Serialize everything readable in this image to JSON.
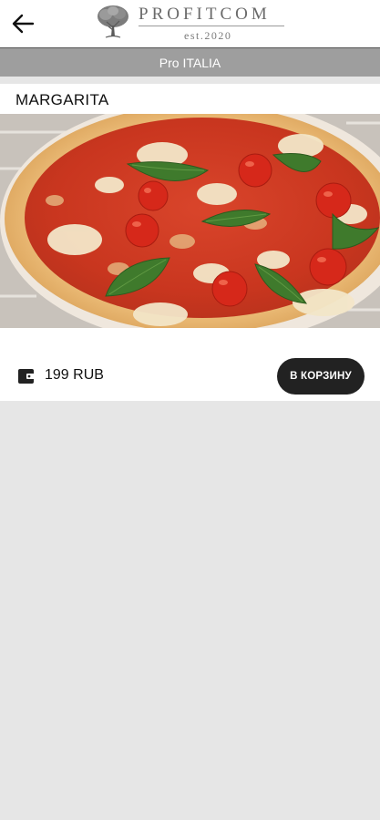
{
  "header": {
    "back_icon": "arrow-left-icon",
    "brand_name": "PROFITCOM",
    "brand_tagline": "est.2020",
    "brand_icon": "tree-logo-icon"
  },
  "category": {
    "label": "Pro ITALIA"
  },
  "product": {
    "title": "MARGARITA",
    "image_description_icon": "pizza-image",
    "price_icon": "wallet-icon",
    "price": "199 RUB",
    "cart_button_label": "В КОРЗИНУ"
  },
  "colors": {
    "header_bg": "#ffffff",
    "category_bar_bg": "#9e9e9e",
    "page_bg": "#e6e6e6",
    "button_bg": "#222222"
  }
}
